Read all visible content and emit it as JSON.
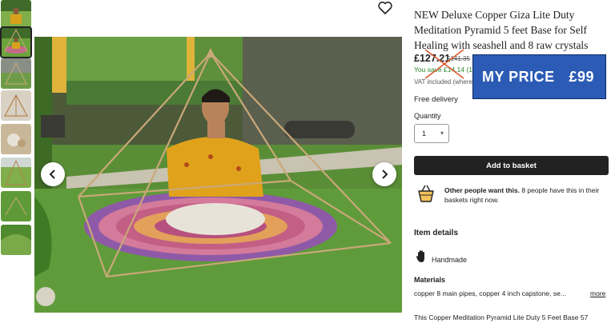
{
  "listing": {
    "title": "NEW Deluxe Copper Giza Lite Duty Meditation Pyramid 5 feet Base for Self Healing with seashell and 8 raw crystals",
    "price": "£127.21",
    "old_price": "£141.35",
    "savings": "You save £14.14 (1",
    "vat": "VAT included (where",
    "delivery": "Free delivery",
    "quantity_label": "Quantity",
    "quantity_value": "1",
    "add_to_basket": "Add to basket",
    "demand_bold": "Other people want this.",
    "demand_rest": " 8 people have this in their baskets right now.",
    "item_details_heading": "Item details",
    "handmade": "Handmade",
    "materials_heading": "Materials",
    "materials": "copper 8 main pipes, copper 4 inch capstone, se...",
    "more": "more",
    "description": "This Copper Meditation Pyramid Lite Duty 5 Feet Base 57"
  },
  "overlay": {
    "my_price_label": "MY PRICE",
    "my_price_value": "£99"
  },
  "icons": {
    "favorite": "heart-icon",
    "prev": "chevron-left-icon",
    "next": "chevron-right-icon",
    "basket": "basket-icon",
    "handmade": "hand-icon",
    "dropdown": "chevron-down-icon"
  },
  "colors": {
    "button": "#222222",
    "overlay_blue": "#2b5bb5",
    "savings_green": "#2a8a2a",
    "cross_red": "#d9542b"
  },
  "thumbnails_count": 7
}
